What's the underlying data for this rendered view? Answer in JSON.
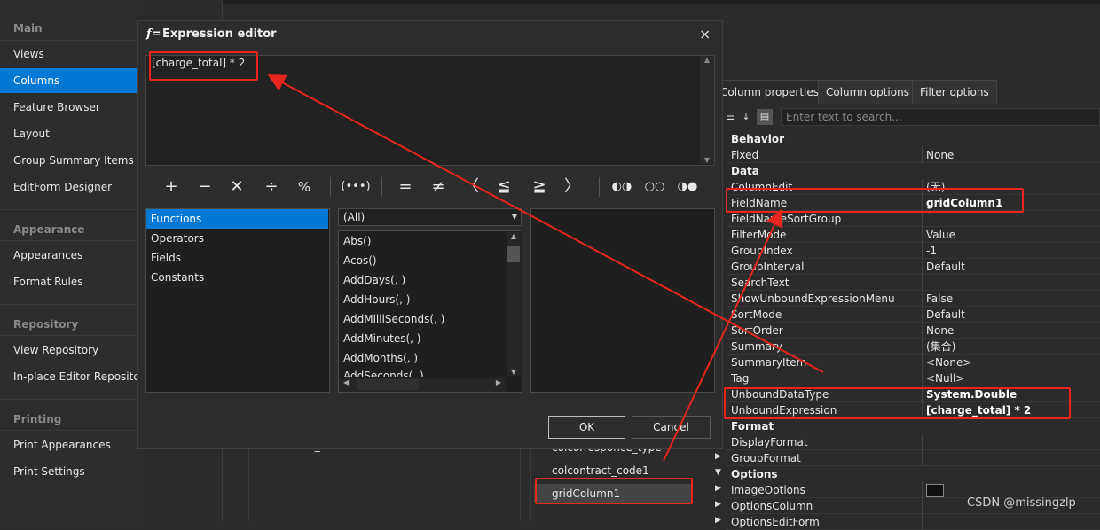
{
  "leftnav": {
    "groups": {
      "main": "Main",
      "appearance": "Appearance",
      "repository": "Repository",
      "printing": "Printing"
    },
    "items": {
      "views": "Views",
      "columns": "Columns",
      "feature_browser": "Feature Browser",
      "layout": "Layout",
      "group_summary": "Group Summary Items",
      "editform": "EditForm Designer",
      "appearances": "Appearances",
      "format_rules": "Format Rules",
      "view_repository": "View Repository",
      "inplace_repository": "In-place Editor Repository",
      "print_appearances": "Print Appearances",
      "print_settings": "Print Settings"
    }
  },
  "dialog": {
    "title": "Expression editor",
    "logo": "f=",
    "close": "×",
    "expression": "[charge_total] * 2",
    "operators": [
      "+",
      "−",
      "×",
      "÷",
      "%",
      "(•••)",
      "=",
      "≠",
      "<",
      "≤",
      ">",
      "≥",
      "AND",
      "OR",
      "NOT"
    ],
    "operator_glyphs": [
      "+",
      "−",
      "✕",
      "÷",
      "%",
      "(•••)",
      "=",
      "≠",
      "〈",
      "≦",
      "≧",
      "〉",
      "◐◑",
      "○○",
      "◑●"
    ],
    "categories": [
      "Functions",
      "Operators",
      "Fields",
      "Constants"
    ],
    "filter": "(All)",
    "functions": [
      "Abs()",
      "Acos()",
      "AddDays(, )",
      "AddHours(, )",
      "AddMilliSeconds(, )",
      "AddMinutes(, )",
      "AddMonths(, )",
      "AddSeconds(, )"
    ],
    "ok": "OK",
    "cancel": "Cancel"
  },
  "propgrid": {
    "tabs": [
      "Column properties",
      "Column options",
      "Filter options"
    ],
    "search_placeholder": "Enter text to search...",
    "categories": {
      "behavior": "Behavior",
      "data": "Data",
      "format": "Format",
      "options": "Options"
    },
    "rows": {
      "fixed": {
        "name": "Fixed",
        "value": "None"
      },
      "columnedit": {
        "name": "ColumnEdit",
        "value": "(无)"
      },
      "fieldname": {
        "name": "FieldName",
        "value": "gridColumn1"
      },
      "fieldnamesortgroup": {
        "name": "FieldNameSortGroup",
        "value": ""
      },
      "filtermode": {
        "name": "FilterMode",
        "value": "Value"
      },
      "groupindex": {
        "name": "GroupIndex",
        "value": "-1"
      },
      "groupinterval": {
        "name": "GroupInterval",
        "value": "Default"
      },
      "searchtext": {
        "name": "SearchText",
        "value": ""
      },
      "showunbound": {
        "name": "ShowUnboundExpressionMenu",
        "value": "False"
      },
      "sortmode": {
        "name": "SortMode",
        "value": "Default"
      },
      "sortorder": {
        "name": "SortOrder",
        "value": "None"
      },
      "summary": {
        "name": "Summary",
        "value": "(集合)"
      },
      "summaryitem": {
        "name": "SummaryItem",
        "value": "<None>"
      },
      "tag": {
        "name": "Tag",
        "value": "<Null>"
      },
      "unbounddatatype": {
        "name": "UnboundDataType",
        "value": "System.Double"
      },
      "unboundexpression": {
        "name": "UnboundExpression",
        "value": "[charge_total] * 2"
      },
      "displayformat": {
        "name": "DisplayFormat",
        "value": ""
      },
      "groupformat": {
        "name": "GroupFormat",
        "value": ""
      },
      "imageoptions": {
        "name": "ImageOptions",
        "value": ""
      },
      "optionscolumn": {
        "name": "OptionsColumn",
        "value": ""
      },
      "optionseditform": {
        "name": "OptionsEditForm",
        "value": ""
      }
    }
  },
  "columns_list": [
    "colcorresponce_type",
    "colcontract_code1",
    "gridColumn1"
  ],
  "bg_left_item": "windows_no",
  "watermark": "CSDN @missingzlp",
  "colors": {
    "accent": "#0078d4",
    "annotation_red": "#e8251f"
  }
}
